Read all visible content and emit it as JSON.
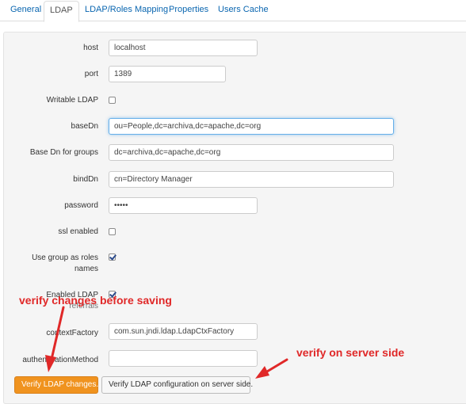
{
  "tabs": [
    {
      "label": "General",
      "active": false
    },
    {
      "label": "LDAP",
      "active": true
    },
    {
      "label": "LDAP/Roles Mapping",
      "active": false
    },
    {
      "label": "Properties",
      "active": false
    },
    {
      "label": "Users Cache",
      "active": false
    }
  ],
  "form": {
    "host": {
      "label": "host",
      "value": "localhost"
    },
    "port": {
      "label": "port",
      "value": "1389"
    },
    "writable_ldap": {
      "label": "Writable LDAP",
      "checked": false
    },
    "base_dn": {
      "label": "baseDn",
      "value": "ou=People,dc=archiva,dc=apache,dc=org"
    },
    "base_dn_groups": {
      "label": "Base Dn for groups",
      "value": "dc=archiva,dc=apache,dc=org"
    },
    "bind_dn": {
      "label": "bindDn",
      "value": "cn=Directory Manager"
    },
    "password": {
      "label": "password",
      "value": "•••••"
    },
    "ssl_enabled": {
      "label": "ssl enabled",
      "checked": false
    },
    "use_group_as_roles": {
      "label_line1": "Use group as roles",
      "label_line2": "names",
      "checked": true
    },
    "enabled_ldap_referrals": {
      "label_line1": "Enabled LDAP",
      "label_line2": "referrals",
      "checked": true
    },
    "context_factory": {
      "label": "contextFactory",
      "value": "com.sun.jndi.ldap.LdapCtxFactory"
    },
    "authentication_method": {
      "label": "authenticationMethod",
      "value": ""
    }
  },
  "buttons": {
    "verify_changes": "Verify LDAP changes.",
    "verify_server": "Verify LDAP configuration on server side."
  },
  "annotations": {
    "before_saving": "verify changes before saving",
    "server_side": "verify on server side",
    "color": "#e02828"
  },
  "colors": {
    "link": "#0a66b0",
    "primary_button": "#f0931f",
    "panel_bg": "#f5f5f5"
  }
}
